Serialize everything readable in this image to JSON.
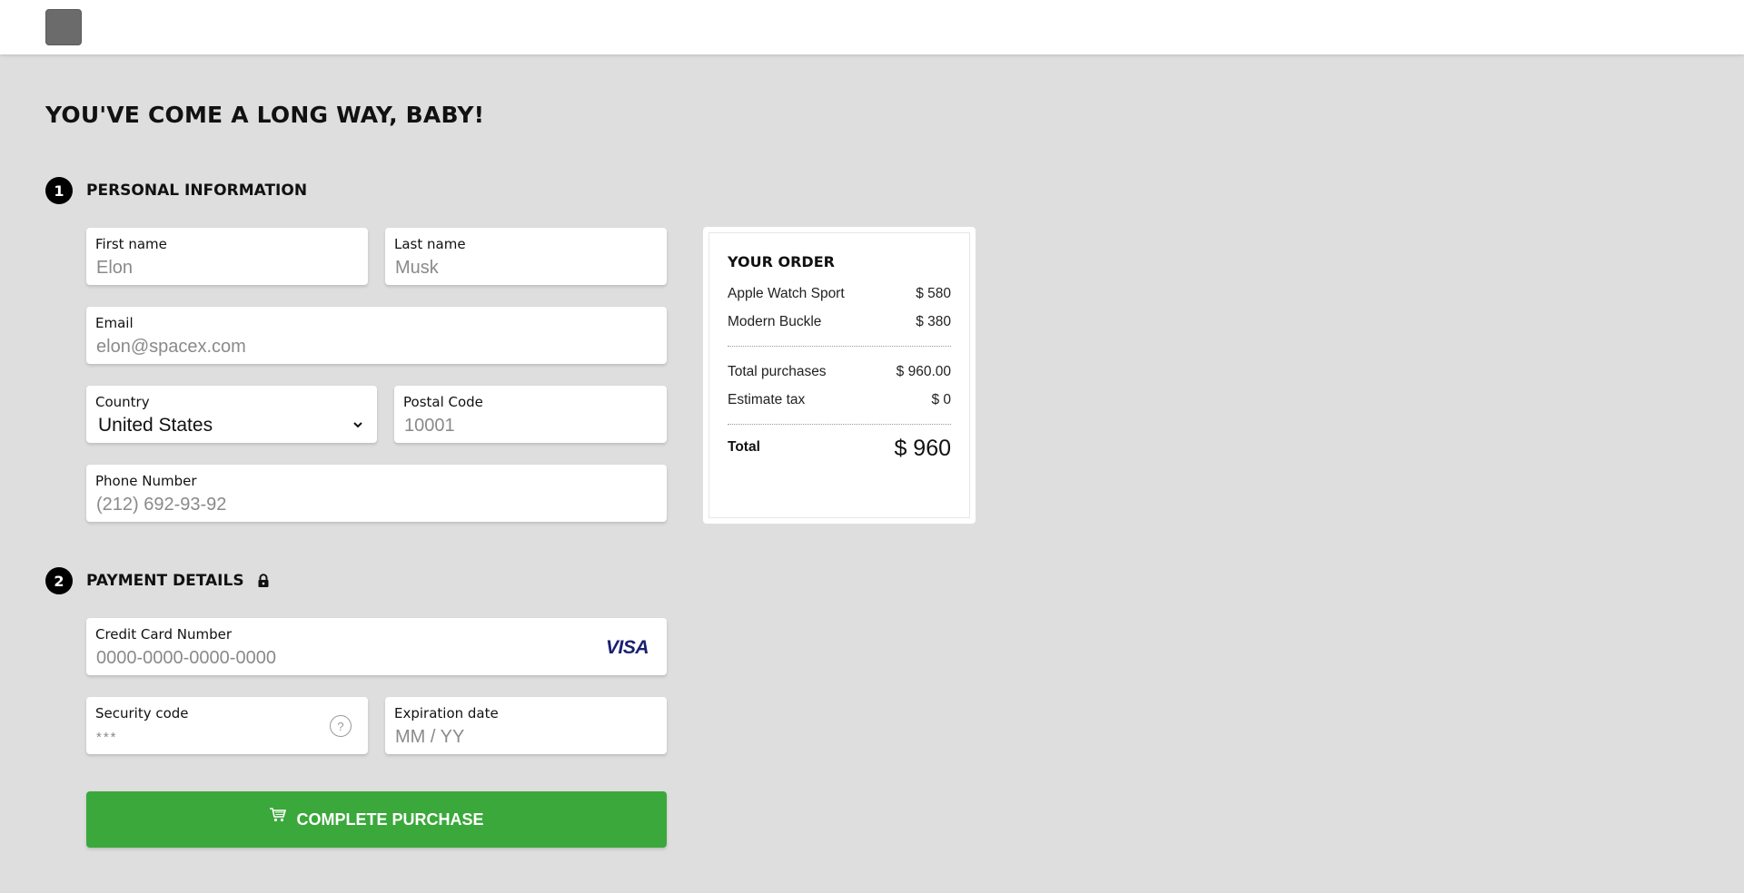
{
  "colors": {
    "background": "#dedede",
    "menu_button": "#6b6b6b",
    "step_badge": "#000000",
    "purchase_button": "#3aa83a",
    "visa_blue": "#1a1f71",
    "visa_gold": "#f7a600"
  },
  "header": {
    "menu_icon": "menu-button-icon"
  },
  "page": {
    "title": "YOU'VE COME A LONG WAY, BABY!"
  },
  "personal": {
    "step_number": "1",
    "title": "PERSONAL INFORMATION",
    "first_name": {
      "label": "First name",
      "placeholder": "Elon"
    },
    "last_name": {
      "label": "Last name",
      "placeholder": "Musk"
    },
    "email": {
      "label": "Email",
      "placeholder": "elon@spacex.com"
    },
    "country": {
      "label": "Country",
      "value": "United States"
    },
    "postal": {
      "label": "Postal Code",
      "placeholder": "10001"
    },
    "phone": {
      "label": "Phone Number",
      "placeholder": "(212) 692-93-92"
    }
  },
  "payment": {
    "step_number": "2",
    "title": "PAYMENT DETAILS",
    "lock_icon": "lock-icon",
    "card": {
      "label": "Credit Card Number",
      "placeholder": "0000-0000-0000-0000",
      "brand": "VISA"
    },
    "security": {
      "label": "Security code",
      "placeholder": "***",
      "help": "?"
    },
    "expiry": {
      "label": "Expiration date",
      "placeholder": "MM / YY"
    },
    "submit_label": "COMPLETE PURCHASE",
    "submit_icon": "cart-icon"
  },
  "order": {
    "title": "YOUR ORDER",
    "items": [
      {
        "name": "Apple Watch Sport",
        "price": "$ 580"
      },
      {
        "name": "Modern Buckle",
        "price": "$ 380"
      }
    ],
    "total_purchases": {
      "label": "Total purchases",
      "value": "$ 960.00"
    },
    "tax": {
      "label": "Estimate tax",
      "value": "$ 0"
    },
    "total": {
      "label": "Total",
      "value": "$ 960"
    }
  }
}
